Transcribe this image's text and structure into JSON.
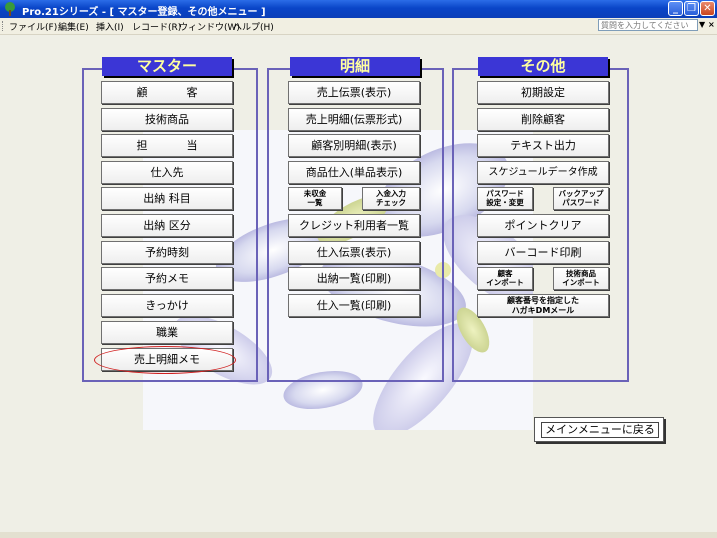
{
  "window": {
    "title": "Pro.21シリーズ - [ マスター登録、その他メニュー ]"
  },
  "menubar": {
    "items": [
      "ファイル(F)",
      "編集(E)",
      "挿入(I)",
      "レコード(R)",
      "ウィンドウ(W)",
      "ヘルプ(H)"
    ],
    "help_placeholder": "質問を入力してください"
  },
  "panels": {
    "master": {
      "title": "マスター",
      "buttons": [
        "顧　客",
        "技術商品",
        "担　当",
        "仕入先",
        "出納 科目",
        "出納 区分",
        "予約時刻",
        "予約メモ",
        "きっかけ",
        "職業",
        "売上明細メモ"
      ]
    },
    "detail": {
      "title": "明細",
      "buttons": [
        "売上伝票(表示)",
        "売上明細(伝票形式)",
        "顧客別明細(表示)",
        "商品仕入(単品表示)",
        "未収金\n一覧",
        "入金入力\nチェック",
        "クレジット利用者一覧",
        "仕入伝票(表示)",
        "出納一覧(印刷)",
        "仕入一覧(印刷)"
      ]
    },
    "other": {
      "title": "その他",
      "buttons": [
        "初期設定",
        "削除顧客",
        "テキスト出力",
        "スケジュールデータ作成",
        "パスワード\n設定・変更",
        "バックアップ\nパスワード",
        "ポイントクリア",
        "バーコード印刷",
        "顧客\nインポート",
        "技術商品\nインポート",
        "顧客番号を指定した\nハガキDMメール"
      ]
    }
  },
  "return_button": "メインメニューに戻る",
  "colors": {
    "title_bar": "#0a45c8",
    "panel_title_bg": "#3b36d6",
    "panel_title_text": "#ffffa0",
    "panel_border": "#6a62b8",
    "highlight": "#d02020"
  }
}
